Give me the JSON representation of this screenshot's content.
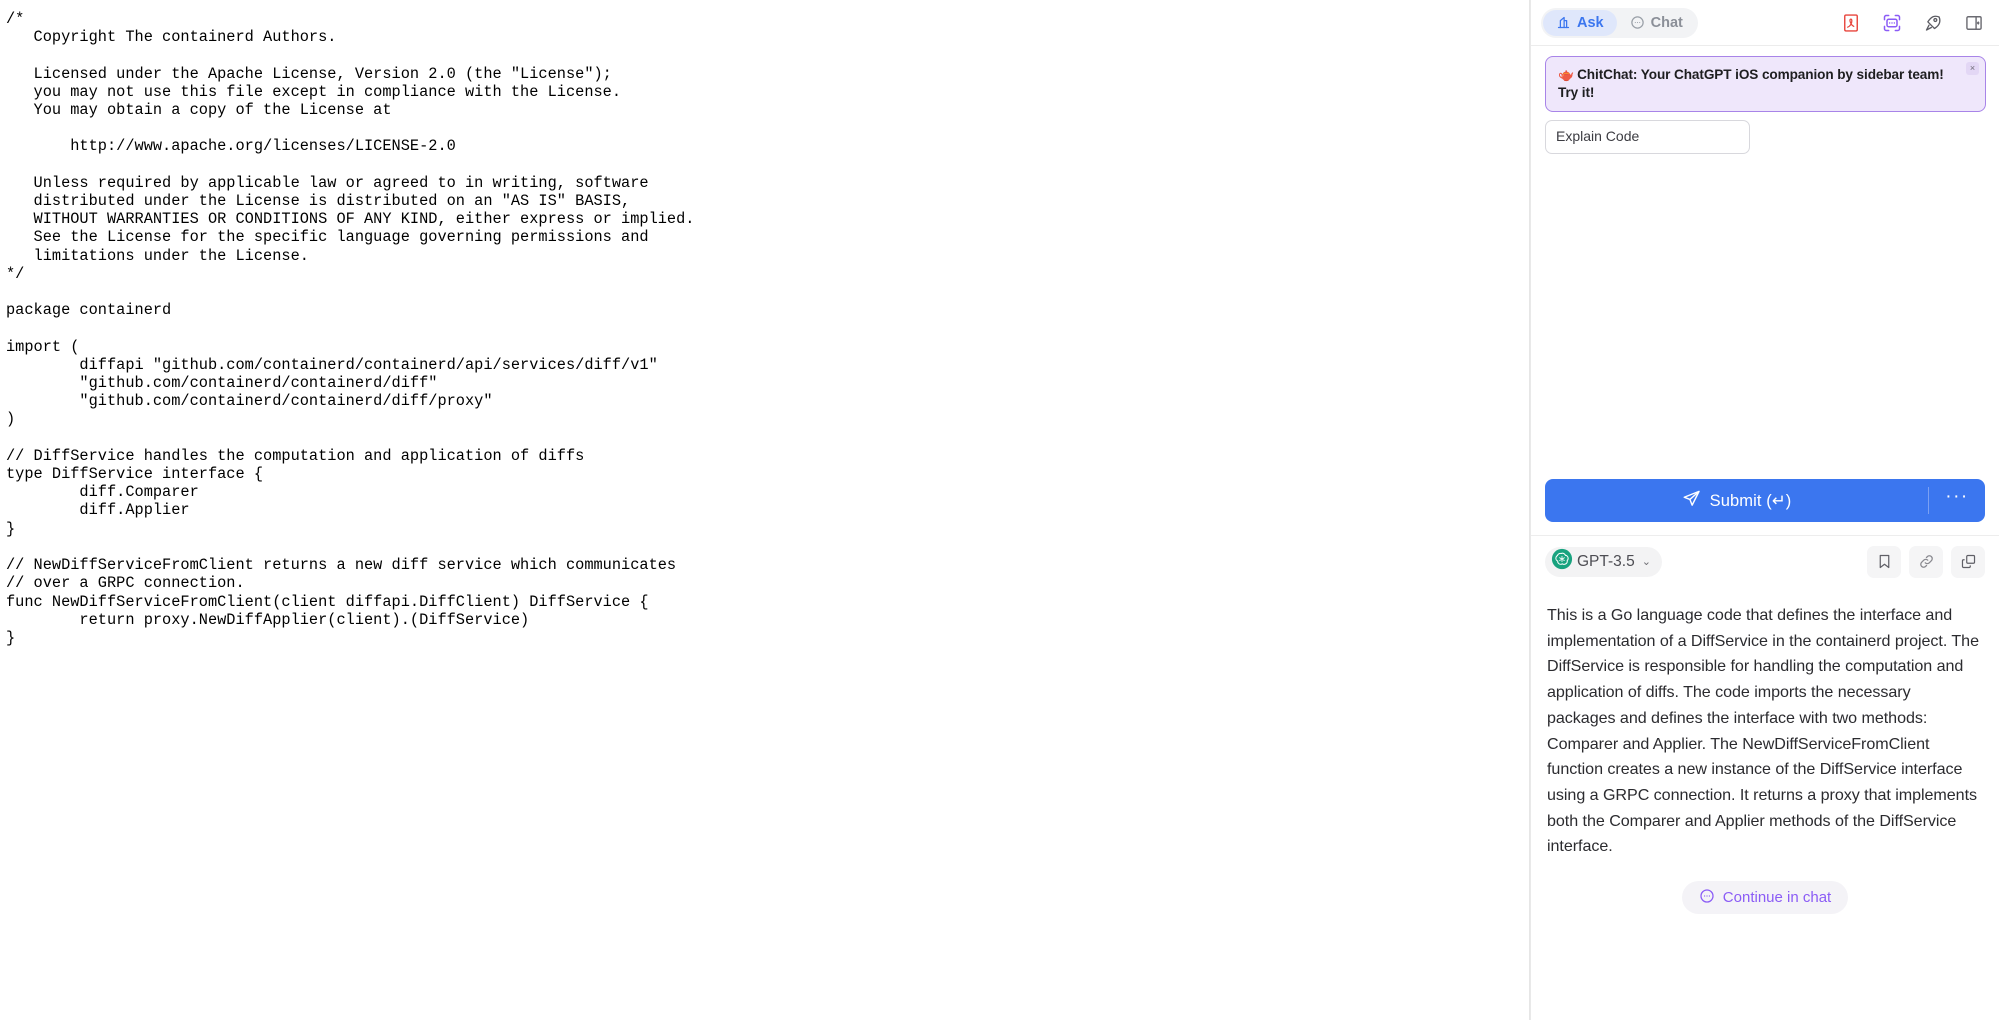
{
  "editor": {
    "language": "go",
    "filename_hint": "containerd diff service",
    "code": "/*\n   Copyright The containerd Authors.\n\n   Licensed under the Apache License, Version 2.0 (the \"License\");\n   you may not use this file except in compliance with the License.\n   You may obtain a copy of the License at\n\n       http://www.apache.org/licenses/LICENSE-2.0\n\n   Unless required by applicable law or agreed to in writing, software\n   distributed under the License is distributed on an \"AS IS\" BASIS,\n   WITHOUT WARRANTIES OR CONDITIONS OF ANY KIND, either express or implied.\n   See the License for the specific language governing permissions and\n   limitations under the License.\n*/\n\npackage containerd\n\nimport (\n        diffapi \"github.com/containerd/containerd/api/services/diff/v1\"\n        \"github.com/containerd/containerd/diff\"\n        \"github.com/containerd/containerd/diff/proxy\"\n)\n\n// DiffService handles the computation and application of diffs\ntype DiffService interface {\n        diff.Comparer\n        diff.Applier\n}\n\n// NewDiffServiceFromClient returns a new diff service which communicates\n// over a GRPC connection.\nfunc NewDiffServiceFromClient(client diffapi.DiffClient) DiffService {\n        return proxy.NewDiffApplier(client).(DiffService)\n}"
  },
  "sidebar": {
    "tabs": [
      {
        "id": "ask",
        "label": "Ask",
        "icon": "ask-icon",
        "active": true
      },
      {
        "id": "chat",
        "label": "Chat",
        "icon": "chat-bubble-icon",
        "active": false
      }
    ],
    "header_icons": [
      {
        "id": "pdf",
        "name": "pdf-icon",
        "color": "#e8453c"
      },
      {
        "id": "screenshot",
        "name": "screenshot-capture-icon",
        "color": "#8b5cf6"
      },
      {
        "id": "rocket",
        "name": "rocket-icon",
        "color": "#5c5c63"
      },
      {
        "id": "panel",
        "name": "toggle-sidebar-icon",
        "color": "#6b6b72"
      }
    ],
    "promo": {
      "emoji": "🫖",
      "text": "ChitChat: Your ChatGPT iOS companion by sidebar team! Try it!",
      "close_label": "×",
      "border_color": "#a884e8",
      "background_color": "#efe7fb"
    },
    "prompt_field": {
      "value": "Explain Code",
      "placeholder": "Explain Code"
    },
    "submit": {
      "label": "Submit (↵)",
      "more_label": "···",
      "accent_color": "#3b76ef"
    },
    "model": {
      "name": "GPT-3.5",
      "chevron": "⌄",
      "badge_color": "#19a37f"
    },
    "model_actions": [
      {
        "id": "bookmark",
        "name": "bookmark-icon"
      },
      {
        "id": "link",
        "name": "link-icon"
      },
      {
        "id": "copy",
        "name": "copy-icon"
      }
    ],
    "answer": {
      "text": "This is a Go language code that defines the interface and implementation of a DiffService in the containerd project. The DiffService is responsible for handling the computation and application of diffs. The code imports the necessary packages and defines the interface with two methods: Comparer and Applier. The NewDiffServiceFromClient function creates a new instance of the DiffService interface using a GRPC connection. It returns a proxy that implements both the Comparer and Applier methods of the DiffService interface."
    },
    "continue": {
      "label": "Continue in chat",
      "color": "#8b5cf6"
    }
  }
}
